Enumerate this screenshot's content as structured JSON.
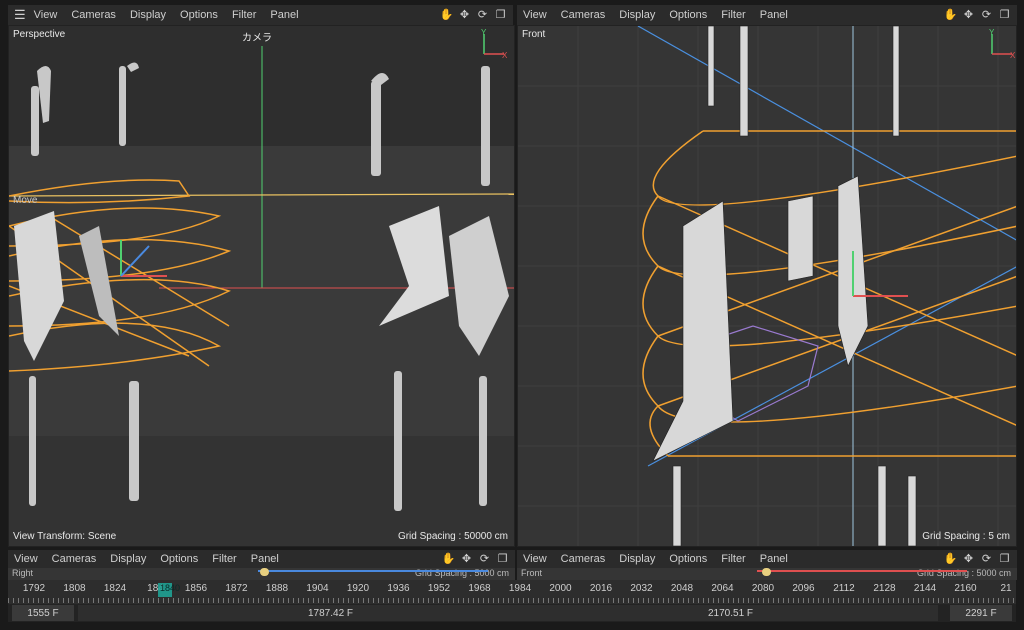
{
  "menu": [
    "View",
    "Cameras",
    "Display",
    "Options",
    "Filter",
    "Panel"
  ],
  "icons": {
    "menu": "hamburger-icon",
    "move": "hand-pan-icon",
    "zoom": "move-arrows-icon",
    "rotate": "rotate-icon",
    "maximize": "maximize-icon"
  },
  "viewport_perspective": {
    "label": "Perspective",
    "camera_label": "カメラ",
    "tool_label": "Move",
    "transform_label": "View Transform: Scene",
    "grid_spacing": "Grid Spacing : 50000 cm"
  },
  "viewport_front": {
    "label": "Front",
    "grid_spacing": "Grid Spacing : 5 cm"
  },
  "bottom_panels": {
    "left_label": "Right",
    "left_grid": "Grid Spacing : 5000 cm",
    "right_label": "Front",
    "right_grid": "Grid Spacing : 5000 cm"
  },
  "timeline": {
    "ticks": [
      "1792",
      "1808",
      "1824",
      "184",
      "1856",
      "1872",
      "1888",
      "1904",
      "1920",
      "1936",
      "1952",
      "1968",
      "1984",
      "2000",
      "2016",
      "2032",
      "2048",
      "2064",
      "2080",
      "2096",
      "2112",
      "2128",
      "2144",
      "2160",
      "21"
    ],
    "current_marker": "1840",
    "start_frame": "1555 F",
    "preview_min": "1787.42 F",
    "preview_max": "2170.51 F",
    "end_frame": "2291 F"
  },
  "colors": {
    "spline": "#f0a030",
    "axis_x": "#e05050",
    "axis_y": "#50d070",
    "axis_z": "#4a8ae0",
    "selection": "#9a7ad0",
    "guide": "#4a90e0"
  }
}
